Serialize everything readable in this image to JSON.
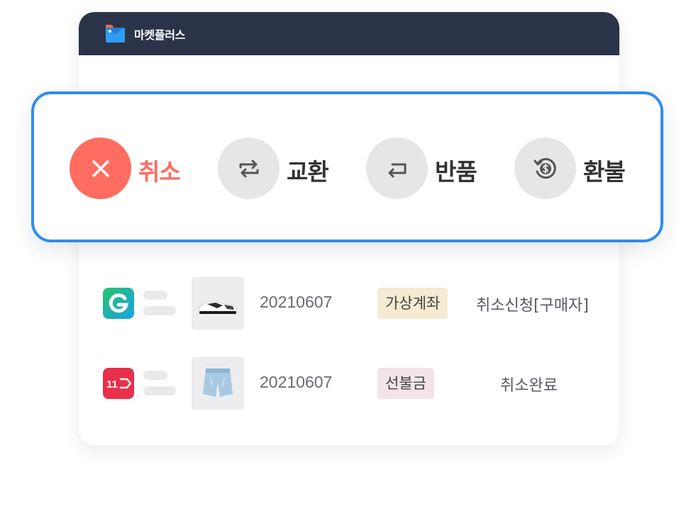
{
  "app": {
    "title": "마켓플러스",
    "logo_icon": "marketplus-logo-icon",
    "header_color": "#2b3348"
  },
  "actions": [
    {
      "label": "취소",
      "icon": "close-icon",
      "active": true,
      "color": "#ff6c60"
    },
    {
      "label": "교환",
      "icon": "exchange-arrows-icon",
      "active": false
    },
    {
      "label": "반품",
      "icon": "return-arrow-icon",
      "active": false
    },
    {
      "label": "환불",
      "icon": "refund-coin-icon",
      "active": false
    }
  ],
  "panel": {
    "border_color": "#2f8cf2"
  },
  "orders": [
    {
      "marketplace_icon": "gmarket-g-icon",
      "product": "sneaker-thumbnail",
      "date": "20210607",
      "payment": "가상계좌",
      "status": "취소신청[구매자]"
    },
    {
      "marketplace_icon": "11st-icon",
      "marketplace_text": "11",
      "product": "denim-shorts-thumbnail",
      "date": "20210607",
      "payment": "선불금",
      "status": "취소완료"
    }
  ]
}
